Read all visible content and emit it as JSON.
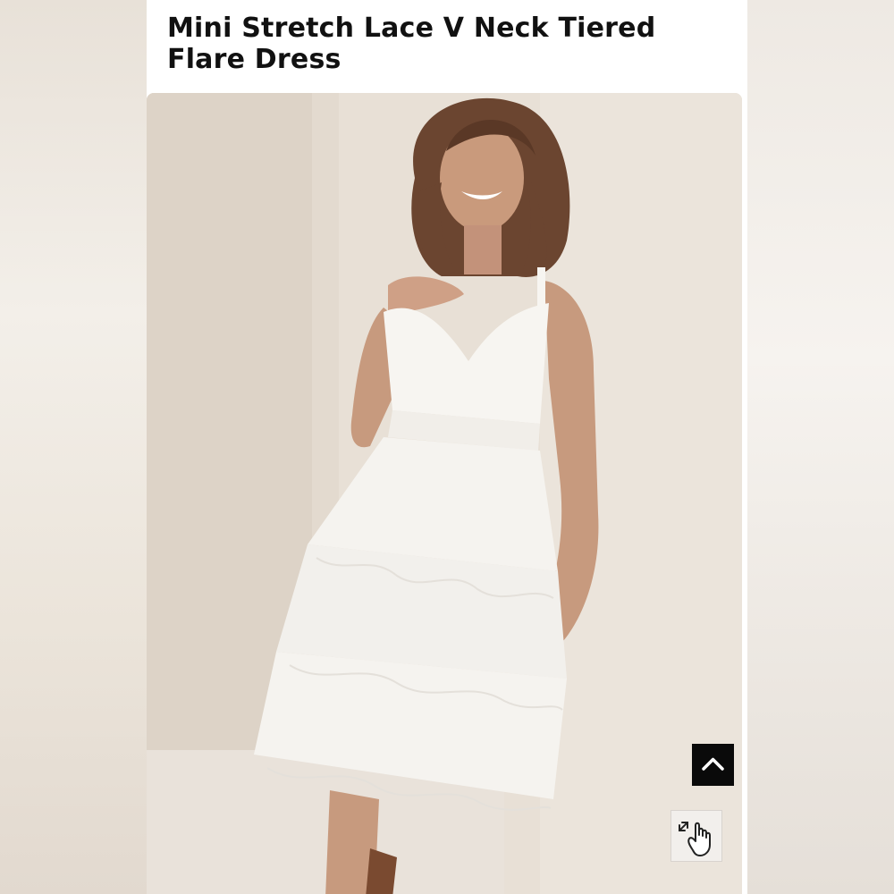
{
  "product": {
    "title": "Mini Stretch Lace V Neck Tiered Flare Dress"
  },
  "image": {
    "subject": "model-in-white-lace-tiered-dress",
    "background_color": "#e6ddd2",
    "dress_color": "#f7f5f1"
  },
  "controls": {
    "scroll_top_icon": "chevron-up-icon",
    "zoom_icon": "pinch-zoom-hand-icon"
  },
  "colors": {
    "title_text": "#111111",
    "button_dark": "#0a0a0a"
  }
}
